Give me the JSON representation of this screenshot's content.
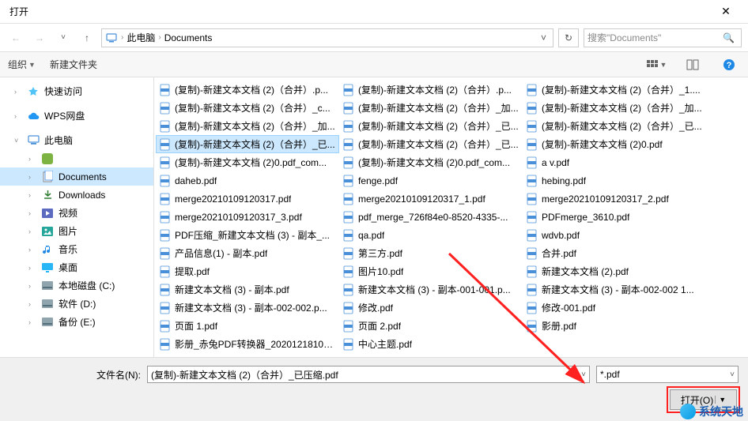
{
  "title": "打开",
  "nav": {
    "pc": "此电脑",
    "folder": "Documents"
  },
  "search_placeholder": "搜索\"Documents\"",
  "toolbar": {
    "organize": "组织",
    "newfolder": "新建文件夹"
  },
  "sidebar": {
    "quickaccess": "快速访问",
    "wps": "WPS网盘",
    "thispc": "此电脑",
    "documents": "Documents",
    "downloads": "Downloads",
    "videos": "视频",
    "pictures": "图片",
    "music": "音乐",
    "desktop": "桌面",
    "diskc": "本地磁盘 (C:)",
    "diskd": "软件 (D:)",
    "diske": "备份 (E:)"
  },
  "files_col1": [
    "(复制)-新建文本文档 (2)（合并）.p...",
    "(复制)-新建文本文档 (2)（合并）_c...",
    "(复制)-新建文本文档 (2)（合并）_加...",
    "(复制)-新建文本文档 (2)（合并）_已...",
    "(复制)-新建文本文档 (2)0.pdf_com...",
    "daheb.pdf",
    "merge20210109120317.pdf",
    "merge20210109120317_3.pdf",
    "PDF压缩_新建文本文档 (3) - 副本_...",
    "产品信息(1) - 副本.pdf",
    "提取.pdf",
    "新建文本文档 (3) - 副本.pdf",
    "新建文本文档 (3) - 副本-002-002.p...",
    "页面 1.pdf",
    "影册_赤兔PDF转换器_20201218102..."
  ],
  "files_col2": [
    "(复制)-新建文本文档 (2)（合并）.p...",
    "(复制)-新建文本文档 (2)（合并）_加...",
    "(复制)-新建文本文档 (2)（合并）_已...",
    "(复制)-新建文本文档 (2)（合并）_已...",
    "(复制)-新建文本文档 (2)0.pdf_com...",
    "fenge.pdf",
    "merge20210109120317_1.pdf",
    "pdf_merge_726f84e0-8520-4335-...",
    "qa.pdf",
    "第三方.pdf",
    "图片10.pdf",
    "新建文本文档 (3) - 副本-001-001.p...",
    "修改.pdf",
    "页面 2.pdf",
    "中心主题.pdf"
  ],
  "files_col3": [
    "(复制)-新建文本文档 (2)（合并）_1....",
    "(复制)-新建文本文档 (2)（合并）_加...",
    "(复制)-新建文本文档 (2)（合并）_已...",
    "(复制)-新建文本文档 (2)0.pdf",
    "a v.pdf",
    "hebing.pdf",
    "merge20210109120317_2.pdf",
    "PDFmerge_3610.pdf",
    "wdvb.pdf",
    "合并.pdf",
    "新建文本文档 (2).pdf",
    "新建文本文档 (3) - 副本-002-002 1...",
    "修改-001.pdf",
    "影册.pdf"
  ],
  "selected_file_index": 3,
  "filename_label": "文件名(N):",
  "filename_value": "(复制)-新建文本文档 (2)（合并）_已压缩.pdf",
  "filter_value": "*.pdf",
  "open_btn": "打开(O)",
  "watermark": "系统天地"
}
